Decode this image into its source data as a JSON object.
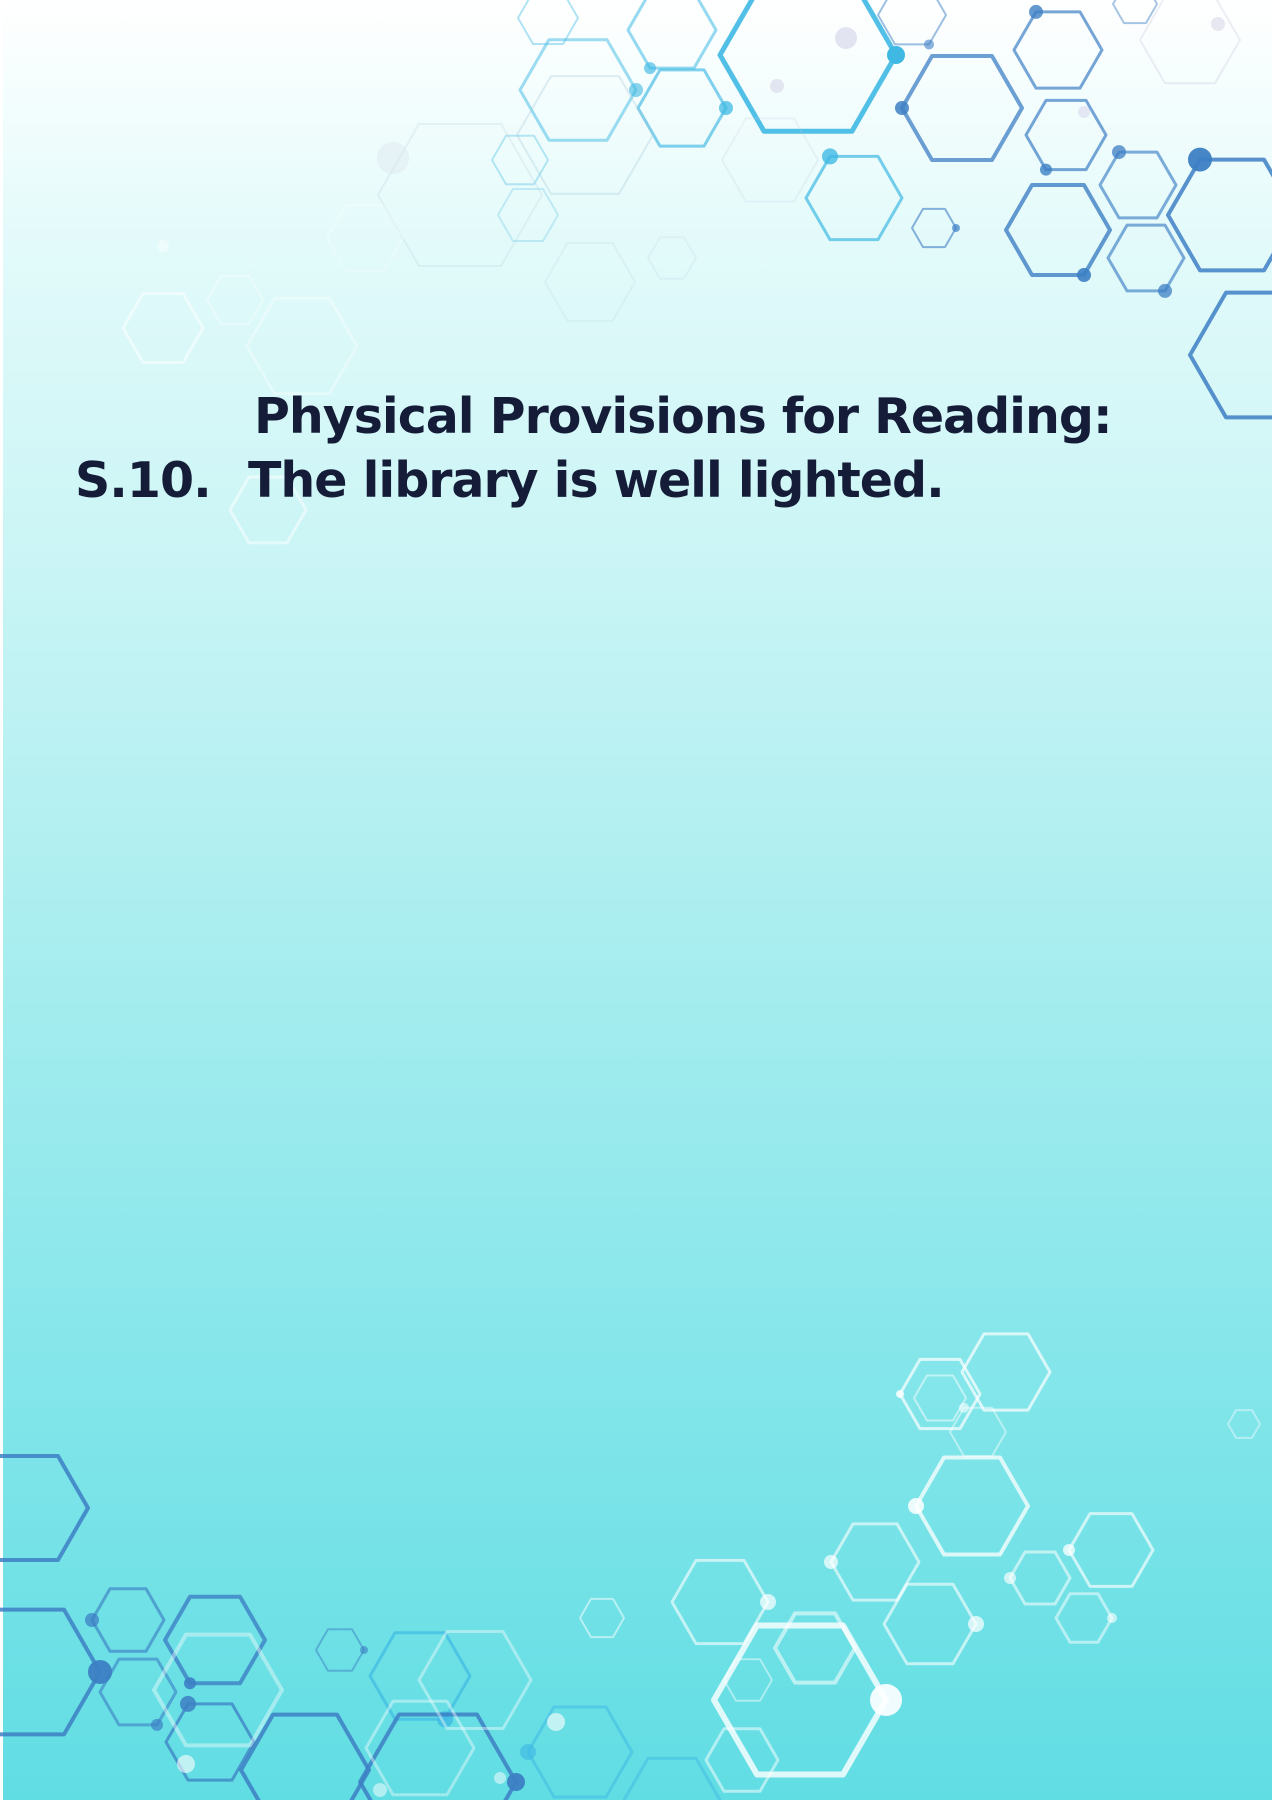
{
  "document": {
    "heading": "Physical Provisions for Reading:",
    "item": {
      "number": "S.10.",
      "statement": "The library is well lighted."
    }
  },
  "colors": {
    "text": "#141c38",
    "hex_dark_blue": "#3d7fc4",
    "hex_cyan": "#3fb9e3",
    "hex_light": "#ffffff",
    "background_top": "#ffffff",
    "background_bottom": "#60dde3"
  }
}
